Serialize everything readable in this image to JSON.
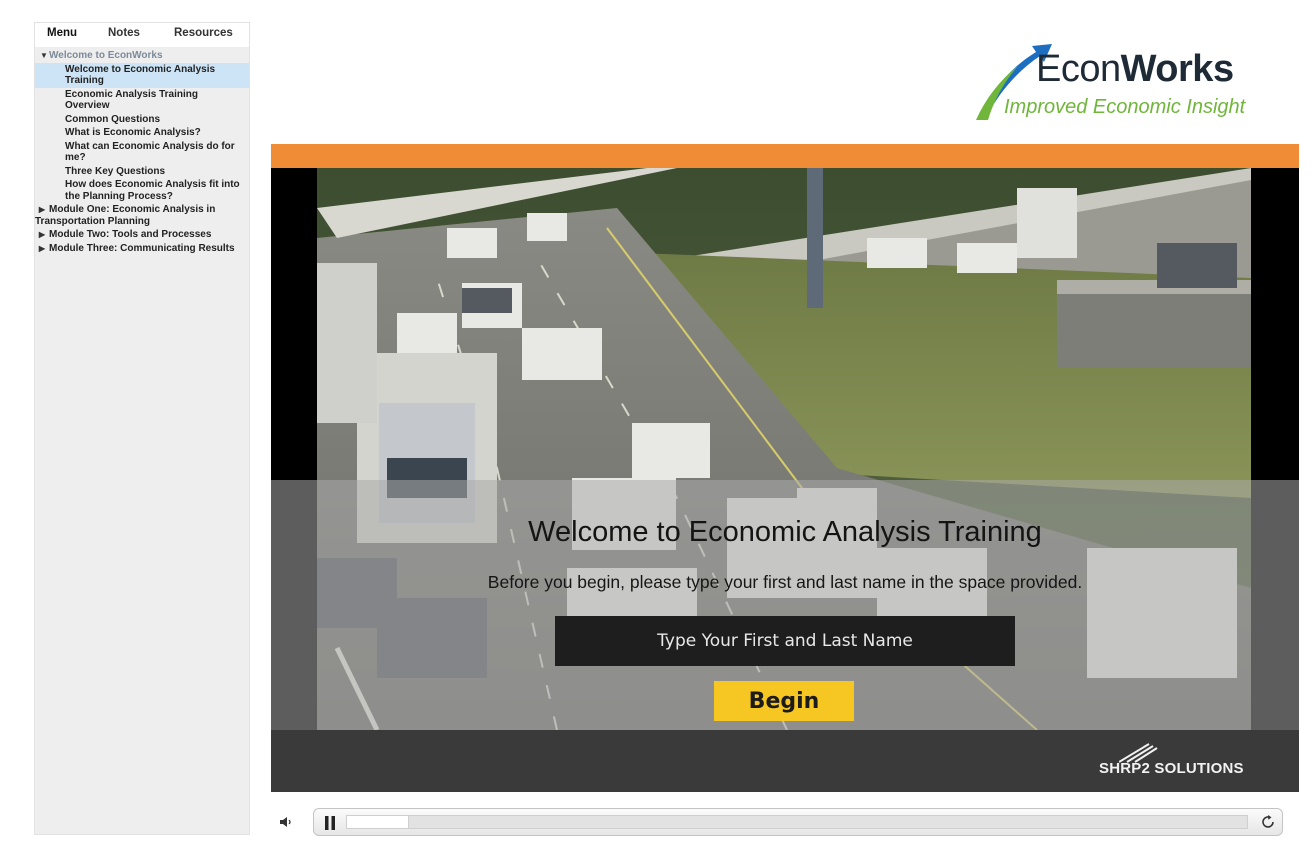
{
  "sidebar": {
    "tabs": [
      "Menu",
      "Notes",
      "Resources"
    ],
    "menu": {
      "section": "Welcome to EconWorks",
      "items": [
        "Welcome to Economic Analysis Training",
        "Economic Analysis Training Overview",
        "Common Questions",
        "What is Economic Analysis?",
        "What can Economic Analysis do for me?",
        "Three Key Questions",
        "How does Economic Analysis fit into the Planning Process?"
      ],
      "modules": [
        "Module One: Economic Analysis in Transportation Planning",
        "Module Two: Tools and Processes",
        "Module Three: Communicating Results"
      ]
    }
  },
  "logo": {
    "name_regular": "Econ",
    "name_bold": "Works",
    "tagline": "Improved Economic Insight"
  },
  "slide": {
    "title": "Welcome to Economic Analysis Training",
    "subtitle": "Before you begin, please type your first and last name in the space provided.",
    "name_placeholder": "Type Your First and Last Name",
    "begin_label": "Begin",
    "footer_logo": "SHRP2 SOLUTIONS"
  },
  "player": {
    "progress_fraction": 0.068
  },
  "colors": {
    "accent_orange": "#f08b36",
    "begin_yellow": "#f6c623",
    "logo_green": "#6fb63a",
    "logo_blue": "#1d6ec1",
    "selected_row": "#cce4f5"
  },
  "icons": {
    "volume": "volume-icon",
    "pause": "pause-icon",
    "replay": "replay-icon"
  }
}
